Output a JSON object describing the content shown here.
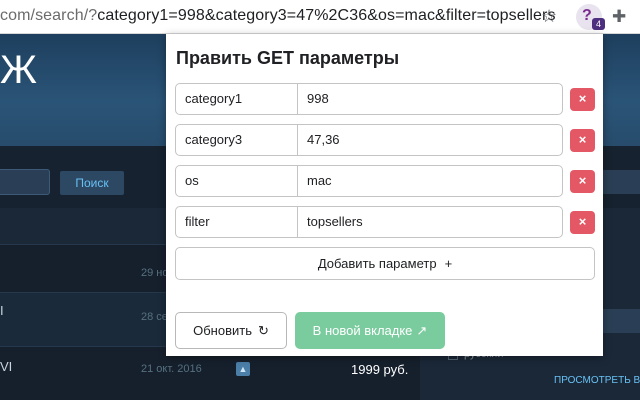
{
  "browser": {
    "url_prefix": "com/search/?",
    "url_query": "category1=998&category3=47%2C36&os=mac&filter=topsellers",
    "star_icon": "star-icon",
    "extension_badge": "4",
    "extension_glyph": "?"
  },
  "page": {
    "hero_letter": "Ж",
    "search_button": "Поиск",
    "results": [
      {
        "title": "",
        "date": "29 но",
        "price": ""
      },
      {
        "title": "I",
        "date": "28 се",
        "price": ""
      },
      {
        "title": "VI",
        "date": "21 окт. 2016",
        "price": "1999 руб."
      }
    ],
    "right_panel": {
      "language": "русский",
      "see_more": "ПРОСМОТРЕТЬ В"
    }
  },
  "popup": {
    "title": "Править GET параметры",
    "params": [
      {
        "key": "category1",
        "value": "998"
      },
      {
        "key": "category3",
        "value": "47,36"
      },
      {
        "key": "os",
        "value": "mac"
      },
      {
        "key": "filter",
        "value": "topsellers"
      }
    ],
    "delete_label": "×",
    "add_label": "Добавить параметр",
    "add_plus": "+",
    "refresh_label": "Обновить",
    "refresh_glyph": "↻",
    "newtab_label": "В новой вкладке",
    "newtab_glyph": "↗",
    "accent": "#7acc9e",
    "danger": "#e45866"
  }
}
